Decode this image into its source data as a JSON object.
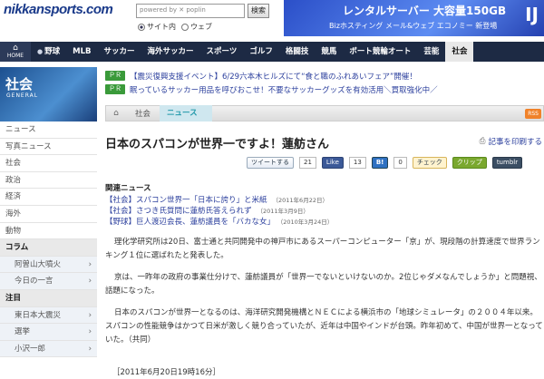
{
  "header": {
    "logo": "nikkansports.com",
    "search_placeholder": "powered by ✕ poplin",
    "search_button": "検索",
    "radio_site": "サイト内",
    "radio_web": "ウェブ",
    "banner_main": "レンタルサーバー 大容量150GB",
    "banner_sub": "Bizホスティング メール&ウェブ エコノミー 新登場",
    "banner_brand": "IJ"
  },
  "nav": {
    "home_label": "HOME",
    "items": [
      "野球",
      "MLB",
      "サッカー",
      "海外サッカー",
      "スポーツ",
      "ゴルフ",
      "格闘技",
      "競馬",
      "ボート競輪オート",
      "芸能",
      "社会"
    ]
  },
  "sidebar": {
    "title": "社会",
    "subtitle": "GENERAL",
    "items": [
      "ニュース",
      "写真ニュース",
      "社会",
      "政治",
      "経済",
      "海外",
      "動物"
    ],
    "column_head": "コラム",
    "column_items": [
      "阿曽山大噴火",
      "今日の一言"
    ],
    "focus_head": "注目",
    "focus_items": [
      "東日本大震災",
      "選挙",
      "小沢一郎"
    ]
  },
  "pr": [
    {
      "tag": "ＰＲ",
      "text": "【震災復興支援イベント】6/29六本木ヒルズにて“食と職のふれあいフェア”開催！"
    },
    {
      "tag": "ＰＲ",
      "text": "眠っているサッカー用品を呼びおこせ！不要なサッカーグッズを有効活用＼買取強化中／"
    }
  ],
  "breadcrumb": {
    "section": "社会",
    "current": "ニュース",
    "rss": "RSS"
  },
  "article": {
    "title": "日本のスパコンが世界一ですよ！蓮舫さん",
    "print": "記事を印刷する",
    "social": {
      "tweet": "ツイートする",
      "tweet_count": "21",
      "like": "Like",
      "like_count": "13",
      "hatena": "B!",
      "hatena_count": "0",
      "check": "チェック",
      "clip": "クリップ",
      "tumblr": "tumblr"
    },
    "related_heading": "関連ニュース",
    "related": [
      {
        "text": "【社会】スパコン世界一「日本に誇り」と米紙",
        "date": "（2011年6月22日）"
      },
      {
        "text": "【社会】さつき氏質問に蓮舫氏答えられず",
        "date": "（2011年3月9日）"
      },
      {
        "text": "【野球】巨人渡辺会長、蓮舫議員を「バカな女」",
        "date": "（2010年3月24日）"
      }
    ],
    "paragraphs": [
      "理化学研究所は20日、富士通と共同開発中の神戸市にあるスーパーコンピューター「京」が、現段階の計算速度で世界ランキング１位に選ばれたと発表した。",
      "京は、一昨年の政府の事業仕分けで、蓮舫議員が「世界一でないといけないのか。2位じゃダメなんでしょうか」と問題視、話題になった。",
      "日本のスパコンが世界一となるのは、海洋研究開発機構とＮＥＣによる横浜市の「地球シミュレータ」の２００４年以来。スパコンの性能競争はかつて日米が激しく競り合っていたが、近年は中国やインドが台頭。昨年初めて、中国が世界一となっていた。（共同）"
    ],
    "timestamp": "［2011年6月20日19時16分］"
  }
}
